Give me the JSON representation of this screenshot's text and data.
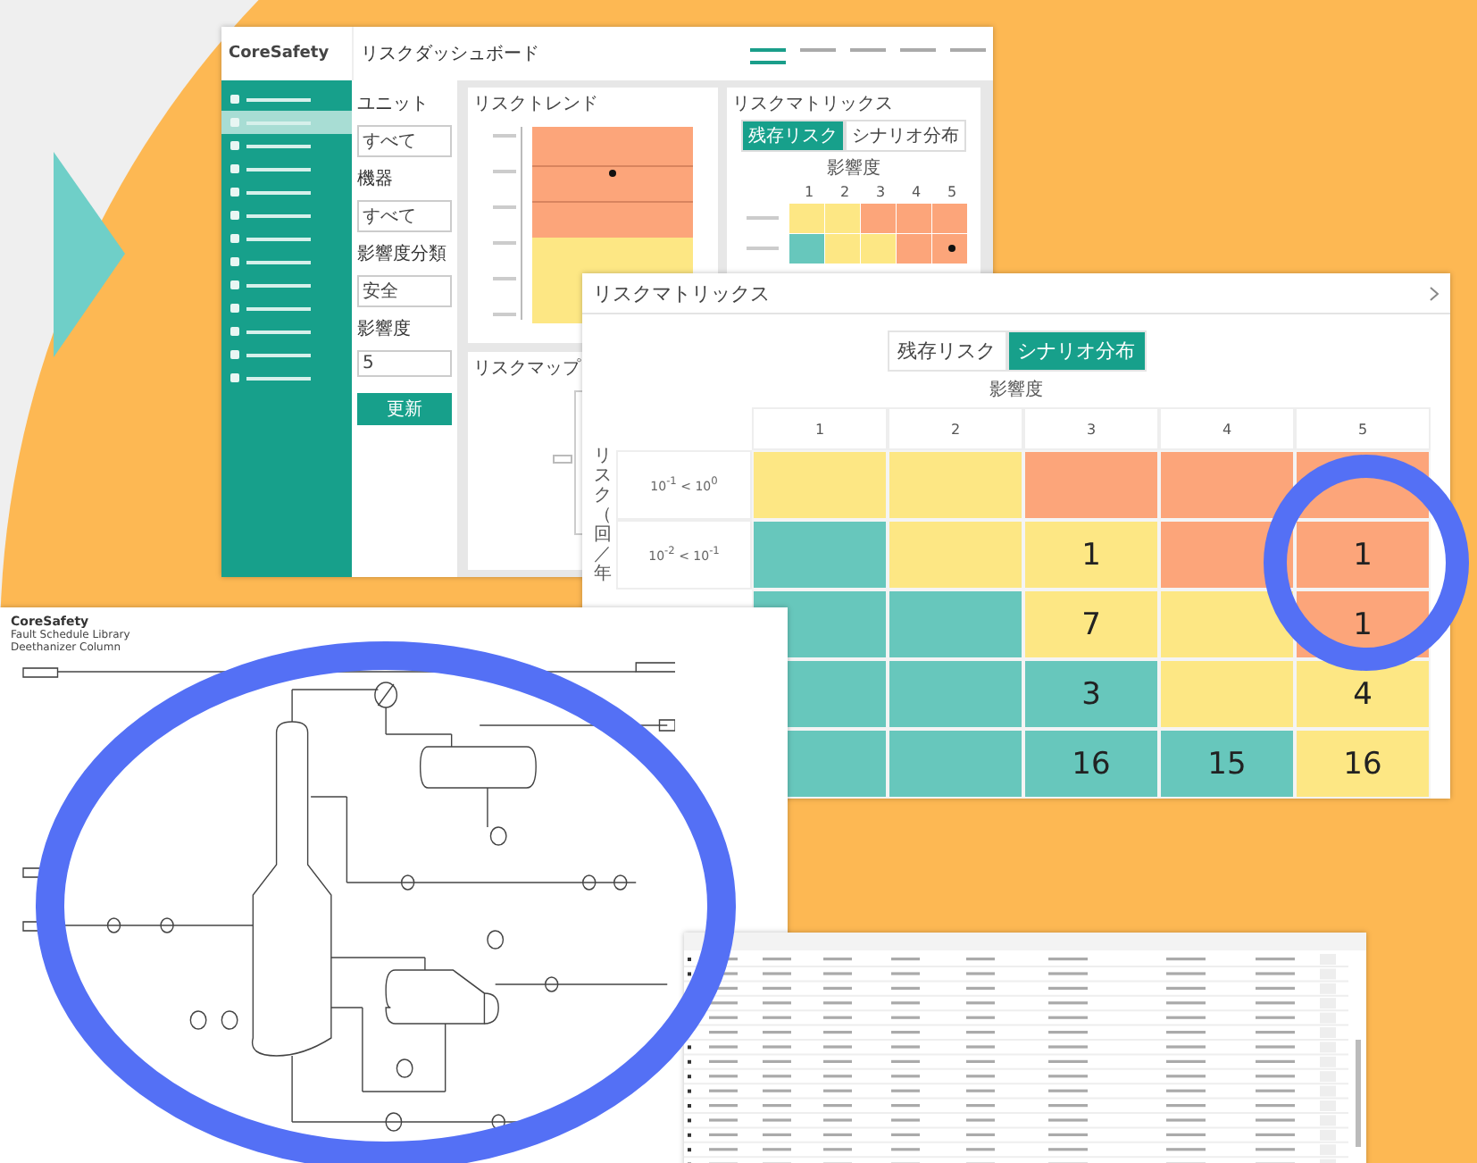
{
  "dashboard": {
    "logo": "CoreSafety",
    "title": "リスクダッシュボード",
    "top_tabs": [
      {
        "selected": true
      },
      {
        "selected": false
      },
      {
        "selected": false
      },
      {
        "selected": false
      },
      {
        "selected": false
      }
    ],
    "sidebar": {
      "items": [
        {
          "selected": false
        },
        {
          "selected": true
        },
        {
          "selected": false
        },
        {
          "selected": false
        },
        {
          "selected": false
        },
        {
          "selected": false
        },
        {
          "selected": false
        },
        {
          "selected": false
        },
        {
          "selected": false
        },
        {
          "selected": false
        },
        {
          "selected": false
        },
        {
          "selected": false
        },
        {
          "selected": false
        }
      ]
    },
    "filters": [
      {
        "label": "ユニット",
        "value": "すべて"
      },
      {
        "label": "機器",
        "value": "すべて"
      },
      {
        "label": "影響度分類",
        "value": "安全"
      },
      {
        "label": "影響度",
        "value": "5"
      }
    ],
    "update_button": "更新",
    "trend_panel": {
      "title": "リスクトレンド"
    },
    "matrix_panel": {
      "title": "リスクマトリックス",
      "toggles": [
        {
          "label": "残存リスク",
          "selected": true
        },
        {
          "label": "シナリオ分布",
          "selected": false
        }
      ],
      "axis_label": "影響度",
      "columns": [
        "1",
        "2",
        "3",
        "4",
        "5"
      ]
    },
    "map_panel": {
      "title": "リスクマップ"
    }
  },
  "matrix_window": {
    "title": "リスクマトリックス",
    "toggles": [
      {
        "label": "残存リスク",
        "selected": false
      },
      {
        "label": "シナリオ分布",
        "selected": true
      }
    ],
    "axis_label": "影響度",
    "row_axis_label": "リスク（回／年",
    "columns": [
      "1",
      "2",
      "3",
      "4",
      "5"
    ],
    "rows": [
      {
        "label": "10$^{-1}$ < 10$^{0}$",
        "cells": [
          {
            "color": "#fde784"
          },
          {
            "color": "#fde784"
          },
          {
            "color": "#fca57a"
          },
          {
            "color": "#fca57a"
          },
          {
            "color": "#fca57a"
          }
        ]
      },
      {
        "label": "10$^{-2}$ < 10$^{-1}$",
        "cells": [
          {
            "color": "#67c7bc"
          },
          {
            "color": "#fde784"
          },
          {
            "color": "#fde784",
            "count": "1"
          },
          {
            "color": "#fca57a"
          },
          {
            "color": "#fca57a",
            "count": "1"
          }
        ]
      },
      {
        "cells": [
          {
            "color": "#67c7bc"
          },
          {
            "color": "#67c7bc"
          },
          {
            "color": "#fde784",
            "count": "7"
          },
          {
            "color": "#fde784"
          },
          {
            "color": "#fca57a",
            "count": "1"
          }
        ]
      },
      {
        "cells": [
          {
            "color": "#67c7bc"
          },
          {
            "color": "#67c7bc"
          },
          {
            "color": "#67c7bc",
            "count": "3"
          },
          {
            "color": "#fde784"
          },
          {
            "color": "#fde784",
            "count": "4"
          }
        ]
      },
      {
        "cells": [
          {
            "color": "#67c7bc"
          },
          {
            "color": "#67c7bc"
          },
          {
            "color": "#67c7bc",
            "count": "16"
          },
          {
            "color": "#67c7bc",
            "count": "15"
          },
          {
            "color": "#fde784",
            "count": "16"
          }
        ]
      }
    ]
  },
  "diagram_window": {
    "logo": "CoreSafety",
    "subtitle": "Fault Schedule Library",
    "name": "Deethanizer Column"
  }
}
